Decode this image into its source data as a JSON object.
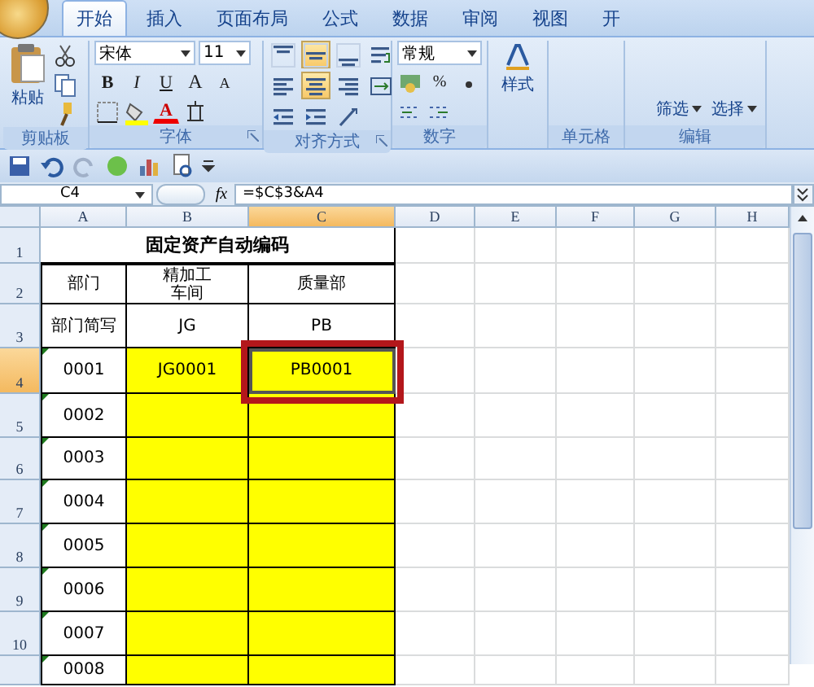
{
  "tabs": [
    {
      "label": "开始",
      "selected": true
    },
    {
      "label": "插入",
      "selected": false
    },
    {
      "label": "页面布局",
      "selected": false
    },
    {
      "label": "公式",
      "selected": false
    },
    {
      "label": "数据",
      "selected": false
    },
    {
      "label": "审阅",
      "selected": false
    },
    {
      "label": "视图",
      "selected": false
    },
    {
      "label": "开",
      "selected": false
    }
  ],
  "ribbon": {
    "clipboard": {
      "paste_label": "粘贴",
      "group_label": "剪贴板"
    },
    "font": {
      "name": "宋体",
      "size": "11",
      "group_label": "字体",
      "buttons": [
        {
          "label": "B",
          "kind": "bold"
        },
        {
          "label": "I",
          "kind": "italic"
        },
        {
          "label": "U",
          "kind": "underline"
        },
        {
          "label": "A",
          "kind": "grow"
        },
        {
          "label": "A",
          "kind": "shrink"
        }
      ],
      "color_button": {
        "label": "A"
      }
    },
    "alignment": {
      "group_label": "对齐方式",
      "buttons": [
        {
          "kind": "top",
          "selected": false
        },
        {
          "kind": "middle",
          "selected": true
        },
        {
          "kind": "bottom",
          "selected": false
        },
        {
          "kind": "wrap",
          "selected": false
        },
        {
          "kind": "left",
          "selected": false
        },
        {
          "kind": "center",
          "selected": true
        },
        {
          "kind": "right",
          "selected": false
        },
        {
          "kind": "merge",
          "selected": false
        },
        {
          "kind": "outdent",
          "selected": false
        },
        {
          "kind": "indent",
          "selected": false
        },
        {
          "kind": "orient",
          "selected": false
        }
      ]
    },
    "number": {
      "format": "常规",
      "percent": "%",
      "group_label": "数字"
    },
    "styles": {
      "label": "样式"
    },
    "cells": {
      "group_label": "单元格"
    },
    "editing": {
      "buttons": [
        "筛选",
        "选择"
      ],
      "group_label": "编辑"
    }
  },
  "formula_bar": {
    "name_box": "C4",
    "fx": "fx",
    "formula": "=$C$3&A4"
  },
  "sheet": {
    "columns": [
      {
        "label": "A",
        "selected": false
      },
      {
        "label": "B",
        "selected": false
      },
      {
        "label": "C",
        "selected": true
      },
      {
        "label": "D",
        "selected": false
      },
      {
        "label": "E",
        "selected": false
      },
      {
        "label": "F",
        "selected": false
      },
      {
        "label": "G",
        "selected": false
      },
      {
        "label": "H",
        "selected": false
      }
    ],
    "rows": [
      {
        "number": "1",
        "selected": false,
        "title": "固定资产自动编码"
      },
      {
        "number": "2",
        "selected": false,
        "cells": [
          {
            "text": "部门",
            "flagged": false,
            "highlighted": false,
            "selected": false
          },
          {
            "lines": [
              "精加工",
              "车间"
            ],
            "highlighted": false,
            "selected": false
          },
          {
            "text": "质量部",
            "highlighted": false,
            "selected": false
          }
        ]
      },
      {
        "number": "3",
        "selected": false,
        "cells": [
          {
            "text": "部门简写",
            "flagged": false,
            "highlighted": false,
            "selected": false
          },
          {
            "text": "JG",
            "highlighted": false,
            "selected": false
          },
          {
            "text": "PB",
            "highlighted": false,
            "selected": false
          }
        ]
      },
      {
        "number": "4",
        "selected": true,
        "cells": [
          {
            "text": "0001",
            "flagged": true,
            "highlighted": false,
            "selected": false
          },
          {
            "text": "JG0001",
            "highlighted": true,
            "selected": false
          },
          {
            "text": "PB0001",
            "highlighted": true,
            "selected": true
          }
        ]
      },
      {
        "number": "5",
        "selected": false,
        "cells": [
          {
            "text": "0002",
            "flagged": true,
            "highlighted": false,
            "selected": false
          },
          {
            "highlighted": true,
            "selected": false
          },
          {
            "highlighted": true,
            "selected": false
          }
        ]
      },
      {
        "number": "6",
        "selected": false,
        "cells": [
          {
            "text": "0003",
            "flagged": true,
            "highlighted": false,
            "selected": false
          },
          {
            "highlighted": true,
            "selected": false
          },
          {
            "highlighted": true,
            "selected": false
          }
        ]
      },
      {
        "number": "7",
        "selected": false,
        "cells": [
          {
            "text": "0004",
            "flagged": true,
            "highlighted": false,
            "selected": false
          },
          {
            "highlighted": true,
            "selected": false
          },
          {
            "highlighted": true,
            "selected": false
          }
        ]
      },
      {
        "number": "8",
        "selected": false,
        "cells": [
          {
            "text": "0005",
            "flagged": true,
            "highlighted": false,
            "selected": false
          },
          {
            "highlighted": true,
            "selected": false
          },
          {
            "highlighted": true,
            "selected": false
          }
        ]
      },
      {
        "number": "9",
        "selected": false,
        "cells": [
          {
            "text": "0006",
            "flagged": true,
            "highlighted": false,
            "selected": false
          },
          {
            "highlighted": true,
            "selected": false
          },
          {
            "highlighted": true,
            "selected": false
          }
        ]
      },
      {
        "number": "10",
        "selected": false,
        "cells": [
          {
            "text": "0007",
            "flagged": true,
            "highlighted": false,
            "selected": false
          },
          {
            "highlighted": true,
            "selected": false
          },
          {
            "highlighted": true,
            "selected": false
          }
        ]
      },
      {
        "selected": false,
        "cells": [
          {
            "text": "0008",
            "flagged": true,
            "highlighted": false,
            "selected": false
          },
          {
            "highlighted": true,
            "selected": false
          },
          {
            "highlighted": true,
            "selected": false
          }
        ]
      }
    ]
  }
}
